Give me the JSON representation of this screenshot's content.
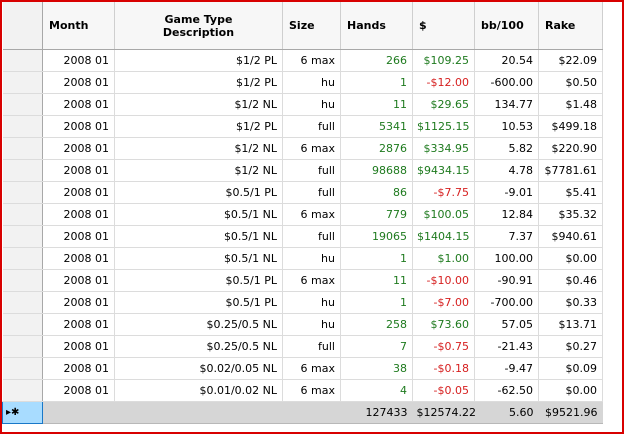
{
  "columns": [
    {
      "key": "month",
      "label": "Month"
    },
    {
      "key": "game",
      "label": "Game Type\nDescription"
    },
    {
      "key": "size",
      "label": "Size"
    },
    {
      "key": "hands",
      "label": "Hands"
    },
    {
      "key": "dollars",
      "label": "$"
    },
    {
      "key": "bb100",
      "label": "bb/100"
    },
    {
      "key": "rake",
      "label": "Rake"
    }
  ],
  "rows": [
    {
      "month": "2008 01",
      "game": "$1/2 PL",
      "size": "6 max",
      "hands": "266",
      "dollars": "$109.25",
      "dollars_sign": "pos",
      "bb100": "20.54",
      "rake": "$22.09"
    },
    {
      "month": "2008 01",
      "game": "$1/2 PL",
      "size": "hu",
      "hands": "1",
      "dollars": "-$12.00",
      "dollars_sign": "neg",
      "bb100": "-600.00",
      "rake": "$0.50"
    },
    {
      "month": "2008 01",
      "game": "$1/2 NL",
      "size": "hu",
      "hands": "11",
      "dollars": "$29.65",
      "dollars_sign": "pos",
      "bb100": "134.77",
      "rake": "$1.48"
    },
    {
      "month": "2008 01",
      "game": "$1/2 PL",
      "size": "full",
      "hands": "5341",
      "dollars": "$1125.15",
      "dollars_sign": "pos",
      "bb100": "10.53",
      "rake": "$499.18"
    },
    {
      "month": "2008 01",
      "game": "$1/2 NL",
      "size": "6 max",
      "hands": "2876",
      "dollars": "$334.95",
      "dollars_sign": "pos",
      "bb100": "5.82",
      "rake": "$220.90"
    },
    {
      "month": "2008 01",
      "game": "$1/2 NL",
      "size": "full",
      "hands": "98688",
      "dollars": "$9434.15",
      "dollars_sign": "pos",
      "bb100": "4.78",
      "rake": "$7781.61"
    },
    {
      "month": "2008 01",
      "game": "$0.5/1 PL",
      "size": "full",
      "hands": "86",
      "dollars": "-$7.75",
      "dollars_sign": "neg",
      "bb100": "-9.01",
      "rake": "$5.41"
    },
    {
      "month": "2008 01",
      "game": "$0.5/1 NL",
      "size": "6 max",
      "hands": "779",
      "dollars": "$100.05",
      "dollars_sign": "pos",
      "bb100": "12.84",
      "rake": "$35.32"
    },
    {
      "month": "2008 01",
      "game": "$0.5/1 NL",
      "size": "full",
      "hands": "19065",
      "dollars": "$1404.15",
      "dollars_sign": "pos",
      "bb100": "7.37",
      "rake": "$940.61"
    },
    {
      "month": "2008 01",
      "game": "$0.5/1 NL",
      "size": "hu",
      "hands": "1",
      "dollars": "$1.00",
      "dollars_sign": "pos",
      "bb100": "100.00",
      "rake": "$0.00"
    },
    {
      "month": "2008 01",
      "game": "$0.5/1 PL",
      "size": "6 max",
      "hands": "11",
      "dollars": "-$10.00",
      "dollars_sign": "neg",
      "bb100": "-90.91",
      "rake": "$0.46"
    },
    {
      "month": "2008 01",
      "game": "$0.5/1 PL",
      "size": "hu",
      "hands": "1",
      "dollars": "-$7.00",
      "dollars_sign": "neg",
      "bb100": "-700.00",
      "rake": "$0.33"
    },
    {
      "month": "2008 01",
      "game": "$0.25/0.5 NL",
      "size": "hu",
      "hands": "258",
      "dollars": "$73.60",
      "dollars_sign": "pos",
      "bb100": "57.05",
      "rake": "$13.71"
    },
    {
      "month": "2008 01",
      "game": "$0.25/0.5 NL",
      "size": "full",
      "hands": "7",
      "dollars": "-$0.75",
      "dollars_sign": "neg",
      "bb100": "-21.43",
      "rake": "$0.27"
    },
    {
      "month": "2008 01",
      "game": "$0.02/0.05 NL",
      "size": "6 max",
      "hands": "38",
      "dollars": "-$0.18",
      "dollars_sign": "neg",
      "bb100": "-9.47",
      "rake": "$0.09"
    },
    {
      "month": "2008 01",
      "game": "$0.01/0.02 NL",
      "size": "6 max",
      "hands": "4",
      "dollars": "-$0.05",
      "dollars_sign": "neg",
      "bb100": "-62.50",
      "rake": "$0.00"
    }
  ],
  "summary": {
    "marker": "▸✱",
    "hands": "127433",
    "dollars": "$12574.22",
    "bb100": "5.60",
    "rake": "$9521.96"
  },
  "colors": {
    "positive": "#1e7a1e",
    "negative": "#d61f1f",
    "frame_border": "#d80000",
    "selection": "#a8dcff"
  }
}
